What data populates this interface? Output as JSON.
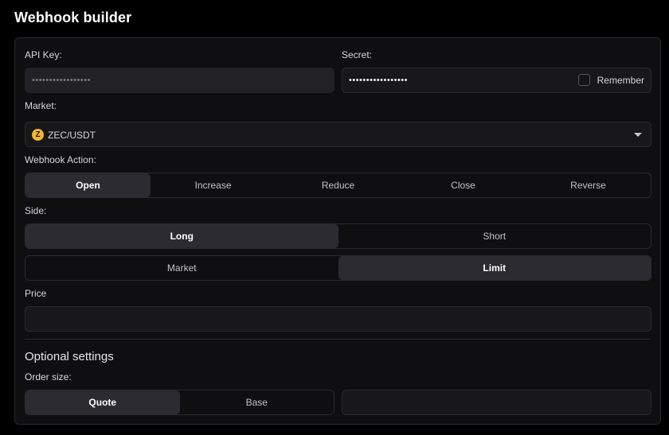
{
  "page": {
    "title": "Webhook builder"
  },
  "form": {
    "api_key": {
      "label": "API Key:",
      "value": "•••••••••••••••••"
    },
    "secret": {
      "label": "Secret:",
      "value": "•••••••••••••••••",
      "remember_label": "Remember",
      "remember_checked": false
    },
    "market": {
      "label": "Market:",
      "value": "ZEC/USDT",
      "coin_glyph": "Z",
      "coin_color": "#f4b728"
    },
    "webhook_action": {
      "label": "Webhook Action:",
      "options": [
        "Open",
        "Increase",
        "Reduce",
        "Close",
        "Reverse"
      ],
      "selected": "Open"
    },
    "side": {
      "label": "Side:",
      "options": [
        "Long",
        "Short"
      ],
      "selected": "Long"
    },
    "order_type": {
      "options": [
        "Market",
        "Limit"
      ],
      "selected": "Limit"
    },
    "price": {
      "label": "Price",
      "value": ""
    },
    "optional": {
      "title": "Optional settings",
      "order_size": {
        "label": "Order size:",
        "options": [
          "Quote",
          "Base"
        ],
        "selected": "Quote",
        "value": ""
      }
    }
  },
  "colors": {
    "background": "#000000",
    "card": "#0f0f11",
    "active_segment": "#2b2b31",
    "border": "#2b2b30"
  }
}
